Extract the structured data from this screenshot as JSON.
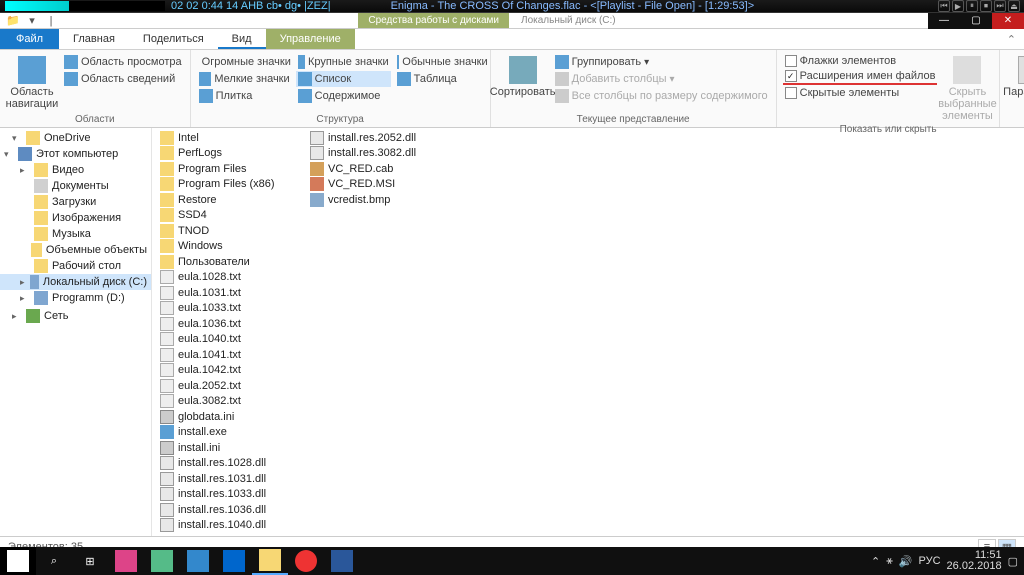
{
  "player": {
    "eq_time": "02   02    0:44 14   AHB cb• dg•   |ZEZ|",
    "track": "Enigma - The CROSS Of Changes.flac  - <[Playlist - File Open] - [1:29:53]>"
  },
  "window": {
    "tool_tab": "Средства работы с дисками",
    "breadcrumb": "Локальный диск (C:)"
  },
  "tabs": {
    "file": "Файл",
    "home": "Главная",
    "share": "Поделиться",
    "view": "Вид",
    "manage": "Управление"
  },
  "ribbon": {
    "nav_pane": "Область навигации",
    "preview_pane": "Область просмотра",
    "details_pane": "Область сведений",
    "panes_label": "Области",
    "xl_icons": "Огромные значки",
    "l_icons": "Крупные значки",
    "m_icons": "Обычные значки",
    "s_icons": "Мелкие значки",
    "list": "Список",
    "table": "Таблица",
    "tiles": "Плитка",
    "content": "Содержимое",
    "layout_label": "Структура",
    "sort": "Сортировать",
    "group": "Группировать",
    "add_cols": "Добавить столбцы",
    "fit_cols": "Все столбцы по размеру содержимого",
    "view_label": "Текущее представление",
    "chk_boxes": "Флажки элементов",
    "ext": "Расширения имен файлов",
    "hidden": "Скрытые элементы",
    "hide_sel": "Скрыть выбранные элементы",
    "showhide_label": "Показать или скрыть",
    "options": "Параметры"
  },
  "tree": [
    {
      "chev": "▾",
      "ico": "folder",
      "label": "OneDrive",
      "indent": 12
    },
    {
      "chev": "▾",
      "ico": "pc",
      "label": "Этот компьютер",
      "indent": 4
    },
    {
      "chev": "▸",
      "ico": "folder",
      "label": "Видео",
      "indent": 20
    },
    {
      "chev": "",
      "ico": "doc",
      "label": "Документы",
      "indent": 20
    },
    {
      "chev": "",
      "ico": "folder",
      "label": "Загрузки",
      "indent": 20
    },
    {
      "chev": "",
      "ico": "folder",
      "label": "Изображения",
      "indent": 20
    },
    {
      "chev": "",
      "ico": "folder",
      "label": "Музыка",
      "indent": 20
    },
    {
      "chev": "",
      "ico": "folder",
      "label": "Объемные объекты",
      "indent": 20
    },
    {
      "chev": "",
      "ico": "folder",
      "label": "Рабочий стол",
      "indent": 20
    },
    {
      "chev": "▸",
      "ico": "drive",
      "label": "Локальный диск (C:)",
      "indent": 20,
      "sel": true
    },
    {
      "chev": "▸",
      "ico": "drive",
      "label": "Programm (D:)",
      "indent": 20
    },
    {
      "chev": "",
      "ico": "",
      "label": "",
      "indent": 0
    },
    {
      "chev": "▸",
      "ico": "net",
      "label": "Сеть",
      "indent": 12
    }
  ],
  "files_col1": [
    {
      "ico": "folder",
      "name": "Intel"
    },
    {
      "ico": "folder",
      "name": "PerfLogs"
    },
    {
      "ico": "folder",
      "name": "Program Files"
    },
    {
      "ico": "folder",
      "name": "Program Files (x86)"
    },
    {
      "ico": "folder",
      "name": "Restore"
    },
    {
      "ico": "folder",
      "name": "SSD4"
    },
    {
      "ico": "folder",
      "name": "TNOD"
    },
    {
      "ico": "folder",
      "name": "Windows"
    },
    {
      "ico": "folder",
      "name": "Пользователи"
    },
    {
      "ico": "txt",
      "name": "eula.1028.txt"
    },
    {
      "ico": "txt",
      "name": "eula.1031.txt"
    },
    {
      "ico": "txt",
      "name": "eula.1033.txt"
    },
    {
      "ico": "txt",
      "name": "eula.1036.txt"
    },
    {
      "ico": "txt",
      "name": "eula.1040.txt"
    },
    {
      "ico": "txt",
      "name": "eula.1041.txt"
    },
    {
      "ico": "txt",
      "name": "eula.1042.txt"
    },
    {
      "ico": "txt",
      "name": "eula.2052.txt"
    },
    {
      "ico": "txt",
      "name": "eula.3082.txt"
    },
    {
      "ico": "ini",
      "name": "globdata.ini"
    },
    {
      "ico": "exe",
      "name": "install.exe"
    },
    {
      "ico": "ini",
      "name": "install.ini"
    },
    {
      "ico": "dll",
      "name": "install.res.1028.dll"
    },
    {
      "ico": "dll",
      "name": "install.res.1031.dll"
    },
    {
      "ico": "dll",
      "name": "install.res.1033.dll"
    },
    {
      "ico": "dll",
      "name": "install.res.1036.dll"
    },
    {
      "ico": "dll",
      "name": "install.res.1040.dll"
    }
  ],
  "files_col2": [
    {
      "ico": "dll",
      "name": "install.res.2052.dll"
    },
    {
      "ico": "dll",
      "name": "install.res.3082.dll"
    },
    {
      "ico": "cab",
      "name": "VC_RED.cab"
    },
    {
      "ico": "msi",
      "name": "VC_RED.MSI"
    },
    {
      "ico": "bmp",
      "name": "vcredist.bmp"
    }
  ],
  "status": {
    "count": "Элементов: 35"
  },
  "tray": {
    "lang": "РУС",
    "time": "11:51",
    "date": "26.02.2018"
  }
}
